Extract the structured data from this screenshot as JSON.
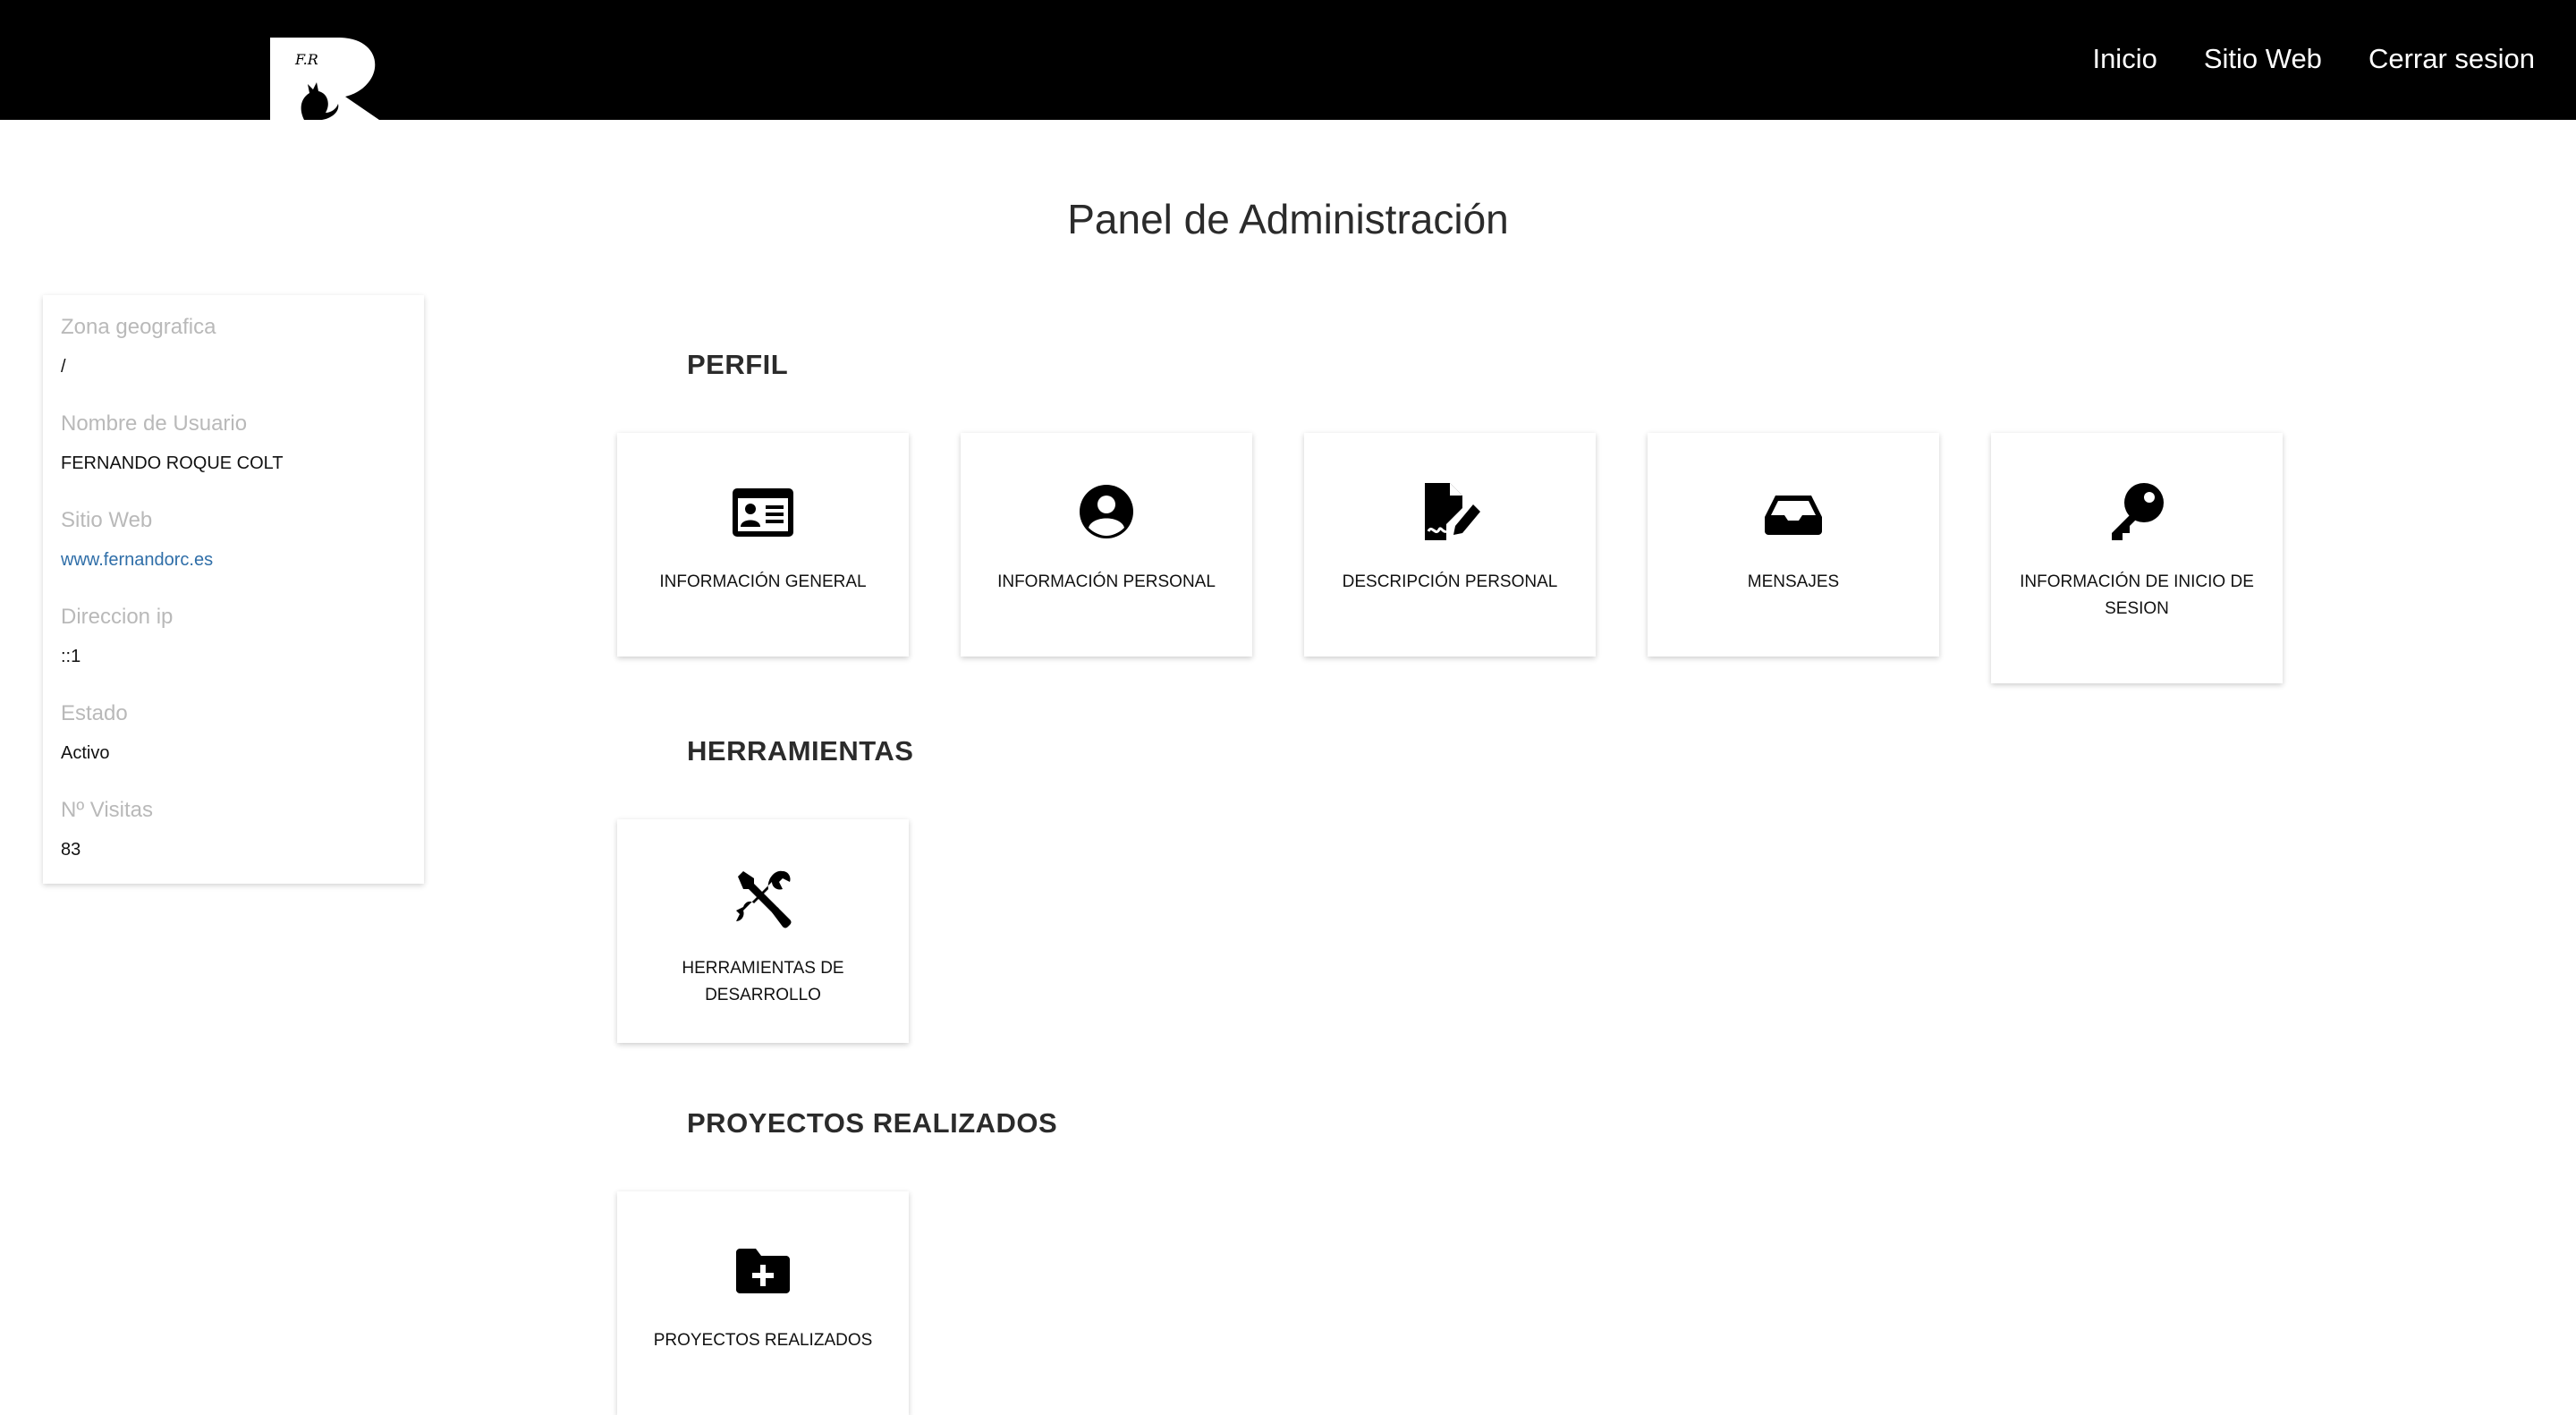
{
  "navbar": {
    "logo_text": "F.R",
    "links": [
      "Inicio",
      "Sitio Web",
      "Cerrar sesion"
    ]
  },
  "page": {
    "title": "Panel de Administración"
  },
  "info": {
    "zona_label": "Zona geografica",
    "zona_value": "/",
    "usuario_label": "Nombre de Usuario",
    "usuario_value": "FERNANDO ROQUE COLT",
    "web_label": "Sitio Web",
    "web_value": "www.fernandorc.es",
    "ip_label": "Direccion ip",
    "ip_value": "::1",
    "estado_label": "Estado",
    "estado_value": "Activo",
    "visitas_label": "Nº Visitas",
    "visitas_value": "83"
  },
  "sections": {
    "perfil": {
      "heading": "PERFIL",
      "cards": [
        {
          "label": "INFORMACIÓN GENERAL",
          "icon": "id-card-icon"
        },
        {
          "label": "INFORMACIÓN PERSONAL",
          "icon": "user-circle-icon"
        },
        {
          "label": "DESCRIPCIÓN PERSONAL",
          "icon": "file-signature-icon"
        },
        {
          "label": "MENSAJES",
          "icon": "inbox-icon"
        },
        {
          "label": "INFORMACIÓN DE INICIO DE SESION",
          "icon": "key-icon"
        }
      ]
    },
    "herramientas": {
      "heading": "HERRAMIENTAS",
      "cards": [
        {
          "label": "HERRAMIENTAS DE DESARROLLO",
          "icon": "tools-icon"
        }
      ]
    },
    "proyectos": {
      "heading": "PROYECTOS REALIZADOS",
      "cards": [
        {
          "label": "PROYECTOS REALIZADOS",
          "icon": "folder-plus-icon"
        }
      ]
    }
  }
}
